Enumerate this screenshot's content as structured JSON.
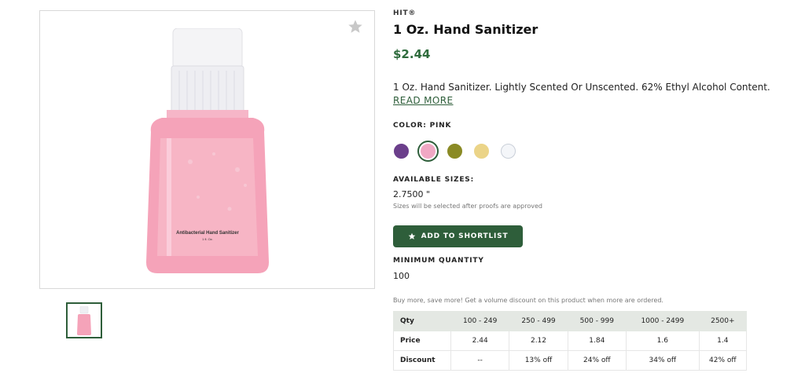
{
  "product": {
    "brand": "HIT®",
    "title": "1 Oz. Hand Sanitizer",
    "price": "$2.44",
    "description": "1 Oz. Hand Sanitizer. Lightly Scented Or Unscented. 62% Ethyl Alcohol Content.",
    "read_more": "READ MORE",
    "image_label": "Antibacterial Hand Sanitizer",
    "image_sublabel": "1 fl. Oz."
  },
  "colors": {
    "label": "COLOR: PINK",
    "swatches": [
      {
        "name": "purple",
        "hex": "#6b3f8b",
        "selected": false
      },
      {
        "name": "pink",
        "hex": "#f0a8c4",
        "selected": true
      },
      {
        "name": "olive",
        "hex": "#8a8a25",
        "selected": false
      },
      {
        "name": "yellow",
        "hex": "#ebd488",
        "selected": false
      },
      {
        "name": "clear",
        "hex": "#f4f6f9",
        "selected": false
      }
    ]
  },
  "sizes": {
    "label": "AVAILABLE SIZES:",
    "value": "2.7500 \"",
    "note": "Sizes will be selected after proofs are approved"
  },
  "shortlist_button": "ADD TO SHORTLIST",
  "minimum": {
    "label": "MINIMUM QUANTITY",
    "value": "100"
  },
  "volume_note": "Buy more, save more! Get a volume discount on this product when more are ordered.",
  "pricing": {
    "headers": [
      "Qty",
      "100 - 249",
      "250 - 499",
      "500 - 999",
      "1000 - 2499",
      "2500+"
    ],
    "rows": [
      [
        "Price",
        "2.44",
        "2.12",
        "1.84",
        "1.6",
        "1.4"
      ],
      [
        "Discount",
        "--",
        "13% off",
        "24% off",
        "34% off",
        "42% off"
      ]
    ]
  }
}
